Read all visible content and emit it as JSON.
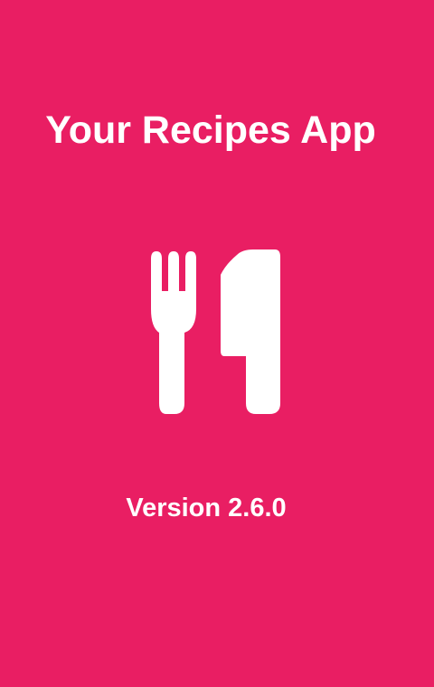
{
  "app": {
    "title": "Your Recipes App",
    "version": "Version 2.6.0",
    "logo_icon": "fork-knife-icon"
  },
  "theme": {
    "background": "#E91E63",
    "foreground": "#FFFFFF"
  }
}
